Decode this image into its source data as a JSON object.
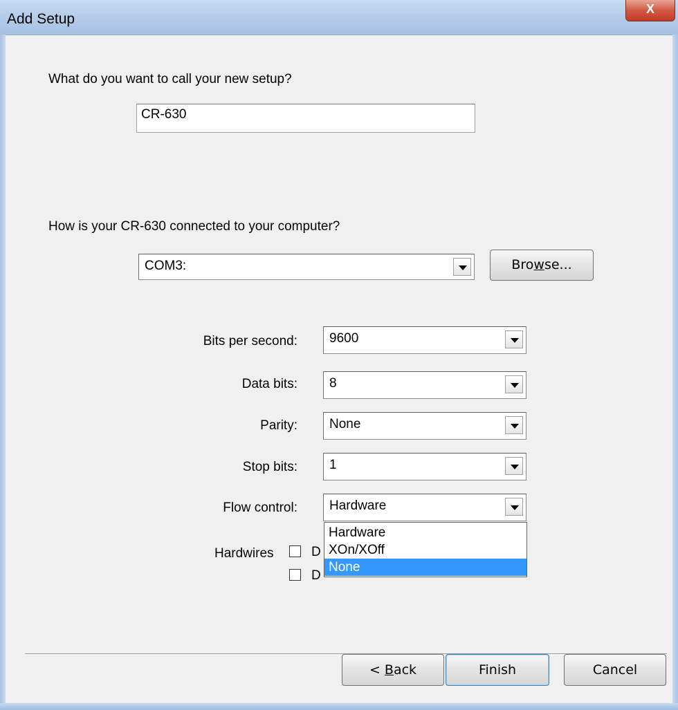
{
  "window": {
    "title": "Add Setup",
    "close_glyph": "X"
  },
  "setup_name": {
    "prompt": "What do you want to call your new setup?",
    "value": "CR-630"
  },
  "connection": {
    "prompt": "How is your CR-630 connected to your computer?",
    "port_value": "COM3:",
    "browse_prefix": "Bro",
    "browse_mnemonic": "w",
    "browse_suffix": "se..."
  },
  "port_settings": {
    "bits_per_second": {
      "label": "Bits per second:",
      "value": "9600"
    },
    "data_bits": {
      "label": "Data bits:",
      "value": "8"
    },
    "parity": {
      "label": "Parity:",
      "value": "None"
    },
    "stop_bits": {
      "label": "Stop bits:",
      "value": "1"
    },
    "flow_control": {
      "label": "Flow control:",
      "value": "Hardware",
      "options": [
        "Hardware",
        "XOn/XOff",
        "None"
      ],
      "highlighted": "None"
    }
  },
  "hardwires": {
    "label": "Hardwires",
    "checkbox1_partial": "D",
    "checkbox2_partial": "D",
    "checkbox1_checked": false,
    "checkbox2_checked": false
  },
  "footer": {
    "back_prefix": "< ",
    "back_mnemonic": "B",
    "back_suffix": "ack",
    "finish_label": "Finish",
    "cancel_label": "Cancel"
  }
}
